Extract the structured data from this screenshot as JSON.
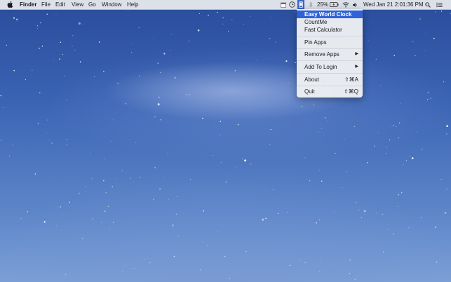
{
  "menubar": {
    "app_name": "Finder",
    "menus": [
      "File",
      "Edit",
      "View",
      "Go",
      "Window",
      "Help"
    ],
    "battery": "25%",
    "clock": "Wed Jan 21  2:01:36 PM",
    "status_icons": [
      "calendar-icon",
      "clock-icon",
      "app-selected-icon",
      "bluetooth-icon",
      "battery-icon",
      "wifi-icon",
      "volume-icon",
      "spotlight-icon",
      "notification-list-icon"
    ]
  },
  "dropdown": {
    "items": [
      {
        "label": "Easy World Clock",
        "highlighted": true
      },
      {
        "label": "CountMe"
      },
      {
        "label": "Fast Calculator"
      },
      {
        "label": "Pin Apps"
      },
      {
        "label": "Remove Apps",
        "submenu": true
      },
      {
        "label": "Add To Login",
        "submenu": true
      },
      {
        "label": "About",
        "shortcut": "⇧⌘A"
      },
      {
        "label": "Quit",
        "shortcut": "⇧⌘Q"
      }
    ]
  },
  "colors": {
    "menubar_bg": "#e8eaee",
    "highlight": "#2f62d8",
    "wallpaper_top": "#2a4c9b",
    "wallpaper_bottom": "#7c9fd6"
  }
}
